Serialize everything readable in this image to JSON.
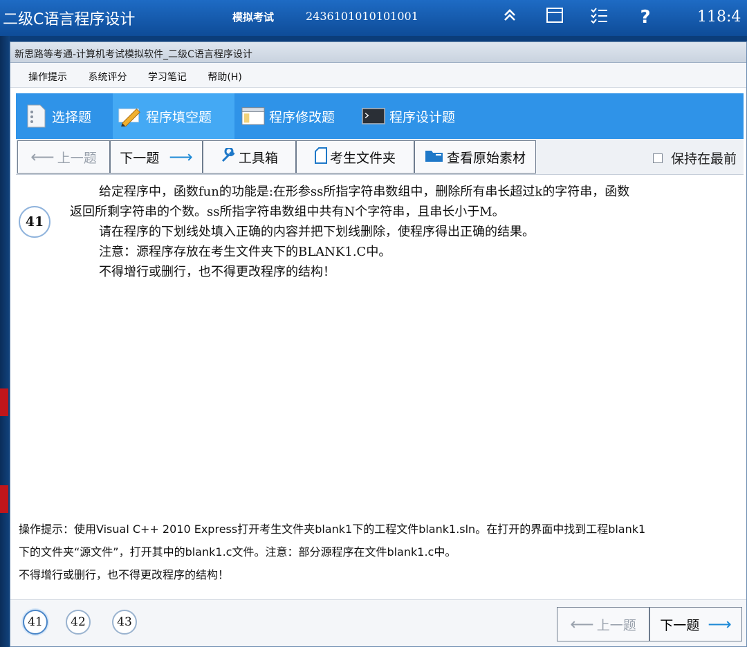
{
  "topbar": {
    "app_title": "二级C语言程序设计",
    "mode": "模拟考试",
    "exam_number": "2436101010101001",
    "timer": "118:4"
  },
  "window": {
    "title": "新思路等考通-计算机考试模拟软件_二级C语言程序设计"
  },
  "menu": [
    "操作提示",
    "系统评分",
    "学习笔记",
    "帮助(H)"
  ],
  "question_types": [
    {
      "label": "选择题",
      "icon": "list-doc-icon"
    },
    {
      "label": "程序填空题",
      "icon": "pencil-icon",
      "active": true
    },
    {
      "label": "程序修改题",
      "icon": "window-edit-icon"
    },
    {
      "label": "程序设计题",
      "icon": "console-icon"
    }
  ],
  "nav": {
    "prev": "上一题",
    "next": "下一题",
    "toolbox": "工具箱",
    "student_folder": "考生文件夹",
    "view_source": "查看原始素材",
    "keep_on_top": "保持在最前"
  },
  "question": {
    "number": "41",
    "lines": [
      "给定程序中，函数fun的功能是:在形参ss所指字符串数组中，删除所有串长超过k的字符串，函数",
      "返回所剩字符串的个数。ss所指字符串数组中共有N个字符串，且串长小于M。",
      "请在程序的下划线处填入正确的内容并把下划线删除，使程序得出正确的结果。",
      "注意：源程序存放在考生文件夹下的BLANK1.C中。",
      "不得增行或删行，也不得更改程序的结构！"
    ]
  },
  "hint": {
    "lines": [
      "操作提示：使用Visual C++ 2010 Express打开考生文件夹blank1下的工程文件blank1.sln。在打开的界面中找到工程blank1",
      "下的文件夹“源文件”，打开其中的blank1.c文件。注意：部分源程序在文件blank1.c中。",
      "不得增行或删行，也不得更改程序的结构！"
    ]
  },
  "question_numbers": [
    "41",
    "42",
    "43"
  ],
  "colors": {
    "accent": "#2f93e8",
    "arrow": "#1e8ad6"
  }
}
